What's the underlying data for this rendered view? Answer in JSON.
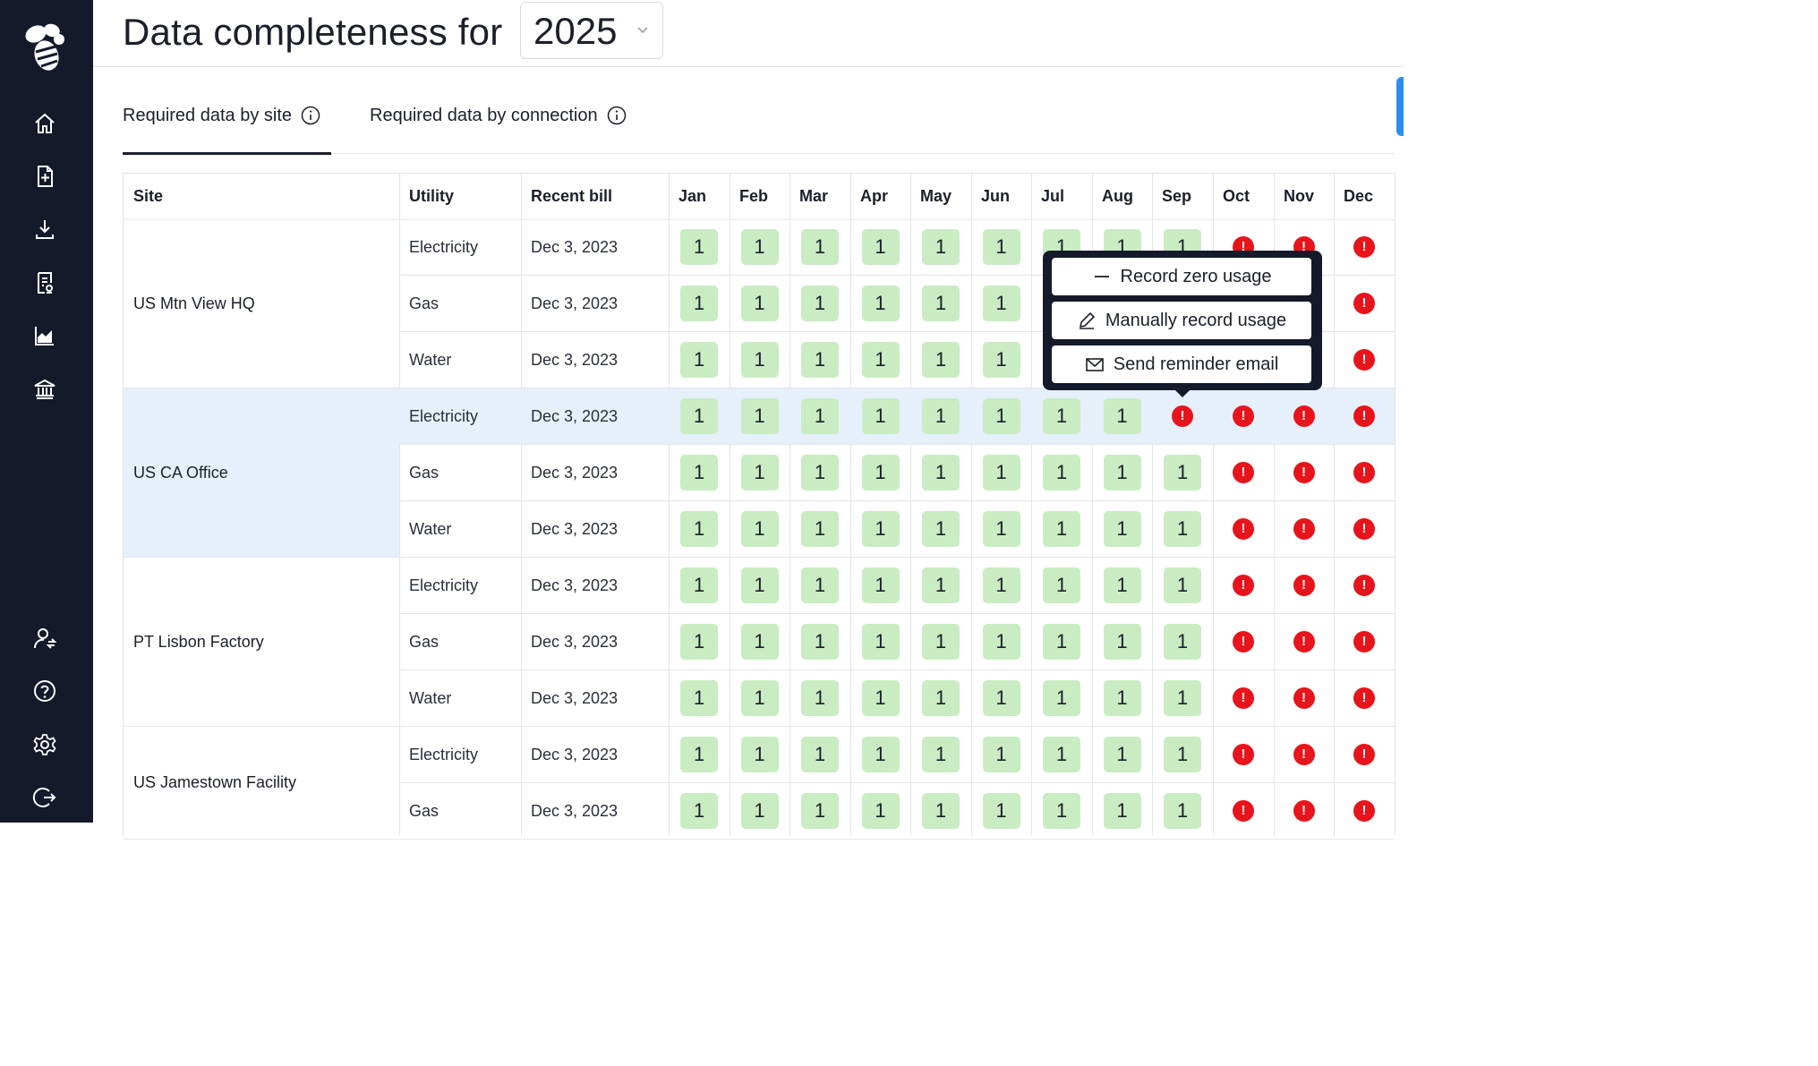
{
  "page": {
    "title": "Data completeness for",
    "year": "2025"
  },
  "sidebar": {
    "items": [
      {
        "icon": "home-icon"
      },
      {
        "icon": "add-document-icon"
      },
      {
        "icon": "download-icon"
      },
      {
        "icon": "report-icon"
      },
      {
        "icon": "chart-icon"
      },
      {
        "icon": "bank-icon"
      },
      {
        "icon": "user-switch-icon"
      },
      {
        "icon": "help-icon"
      },
      {
        "icon": "settings-icon"
      },
      {
        "icon": "logout-icon"
      }
    ]
  },
  "tabs": [
    {
      "label": "Required data by site",
      "active": true
    },
    {
      "label": "Required data by connection",
      "active": false
    }
  ],
  "table": {
    "columns": [
      "Site",
      "Utility",
      "Recent bill",
      "Jan",
      "Feb",
      "Mar",
      "Apr",
      "May",
      "Jun",
      "Jul",
      "Aug",
      "Sep",
      "Oct",
      "Nov",
      "Dec"
    ],
    "sites": [
      {
        "name": "US Mtn View HQ",
        "highlight": false,
        "rows": [
          {
            "utility": "Electricity",
            "recent_bill": "Dec 3, 2023",
            "months": [
              "1",
              "1",
              "1",
              "1",
              "1",
              "1",
              "1",
              "1",
              "1",
              "!",
              "!",
              "!"
            ]
          },
          {
            "utility": "Gas",
            "recent_bill": "Dec 3, 2023",
            "months": [
              "1",
              "1",
              "1",
              "1",
              "1",
              "1",
              "",
              "",
              "",
              "",
              "",
              "!"
            ]
          },
          {
            "utility": "Water",
            "recent_bill": "Dec 3, 2023",
            "months": [
              "1",
              "1",
              "1",
              "1",
              "1",
              "1",
              "",
              "",
              "",
              "",
              "",
              "!"
            ]
          }
        ]
      },
      {
        "name": "US CA Office",
        "highlight": true,
        "rows": [
          {
            "utility": "Electricity",
            "recent_bill": "Dec 3, 2023",
            "months": [
              "1",
              "1",
              "1",
              "1",
              "1",
              "1",
              "1",
              "1",
              "!",
              "!",
              "!",
              "!"
            ]
          },
          {
            "utility": "Gas",
            "recent_bill": "Dec 3, 2023",
            "months": [
              "1",
              "1",
              "1",
              "1",
              "1",
              "1",
              "1",
              "1",
              "1",
              "!",
              "!",
              "!"
            ]
          },
          {
            "utility": "Water",
            "recent_bill": "Dec 3, 2023",
            "months": [
              "1",
              "1",
              "1",
              "1",
              "1",
              "1",
              "1",
              "1",
              "1",
              "!",
              "!",
              "!"
            ]
          }
        ]
      },
      {
        "name": "PT Lisbon Factory",
        "highlight": false,
        "rows": [
          {
            "utility": "Electricity",
            "recent_bill": "Dec 3, 2023",
            "months": [
              "1",
              "1",
              "1",
              "1",
              "1",
              "1",
              "1",
              "1",
              "1",
              "!",
              "!",
              "!"
            ]
          },
          {
            "utility": "Gas",
            "recent_bill": "Dec 3, 2023",
            "months": [
              "1",
              "1",
              "1",
              "1",
              "1",
              "1",
              "1",
              "1",
              "1",
              "!",
              "!",
              "!"
            ]
          },
          {
            "utility": "Water",
            "recent_bill": "Dec 3, 2023",
            "months": [
              "1",
              "1",
              "1",
              "1",
              "1",
              "1",
              "1",
              "1",
              "1",
              "!",
              "!",
              "!"
            ]
          }
        ]
      },
      {
        "name": "US Jamestown Facility",
        "highlight": false,
        "rows": [
          {
            "utility": "Electricity",
            "recent_bill": "Dec 3, 2023",
            "months": [
              "1",
              "1",
              "1",
              "1",
              "1",
              "1",
              "1",
              "1",
              "1",
              "!",
              "!",
              "!"
            ]
          },
          {
            "utility": "Gas",
            "recent_bill": "Dec 3, 2023",
            "months": [
              "1",
              "1",
              "1",
              "1",
              "1",
              "1",
              "1",
              "1",
              "1",
              "!",
              "!",
              "!"
            ]
          }
        ]
      }
    ]
  },
  "popup": {
    "items": [
      {
        "label": "Record zero usage",
        "icon": "minus-icon"
      },
      {
        "label": "Manually record usage",
        "icon": "pencil-icon"
      },
      {
        "label": "Send reminder email",
        "icon": "envelope-icon"
      }
    ]
  },
  "colors": {
    "sidebar": "#141a2a",
    "ok": "#c9ecc3",
    "missing": "#e8141b",
    "highlight": "#e5f0fb",
    "accent": "#2b8ef0"
  }
}
